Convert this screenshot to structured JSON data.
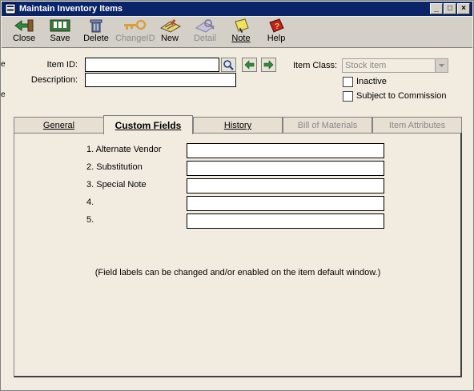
{
  "window": {
    "title": "Maintain Inventory Items"
  },
  "toolbar": {
    "buttons": [
      {
        "label": "Close",
        "icon": "close-icon",
        "enabled": true
      },
      {
        "label": "Save",
        "icon": "save-icon",
        "enabled": true
      },
      {
        "label": "Delete",
        "icon": "delete-icon",
        "enabled": true
      },
      {
        "label": "ChangeID",
        "icon": "change-id-icon",
        "enabled": false
      },
      {
        "label": "New",
        "icon": "new-icon",
        "enabled": true
      },
      {
        "label": "Detail",
        "icon": "detail-icon",
        "enabled": false
      },
      {
        "label": "Note",
        "icon": "note-icon",
        "enabled": true
      },
      {
        "label": "Help",
        "icon": "help-icon",
        "enabled": true
      }
    ]
  },
  "header": {
    "item_id_label": "Item ID:",
    "item_id_value": "",
    "description_label": "Description:",
    "description_value": "",
    "item_class_label": "Item Class:",
    "item_class_value": "Stock item",
    "inactive_label": "Inactive",
    "inactive_checked": false,
    "commission_label": "Subject to Commission",
    "commission_checked": false
  },
  "tabs": [
    {
      "label": "General",
      "active": false,
      "enabled": true
    },
    {
      "label": "Custom Fields",
      "active": true,
      "enabled": true
    },
    {
      "label": "History",
      "active": false,
      "enabled": true
    },
    {
      "label": "Bill of Materials",
      "active": false,
      "enabled": false
    },
    {
      "label": "Item Attributes",
      "active": false,
      "enabled": false
    }
  ],
  "custom_fields": [
    {
      "label": "1. Alternate Vendor",
      "value": ""
    },
    {
      "label": "2. Substitution",
      "value": ""
    },
    {
      "label": "3. Special Note",
      "value": ""
    },
    {
      "label": "4.",
      "value": ""
    },
    {
      "label": "5.",
      "value": ""
    }
  ],
  "note": "(Field labels can be changed and/or enabled on the item default window.)",
  "colors": {
    "titlebar": "#0a246a",
    "window_bg": "#f2ece0",
    "toolbar_bg": "#d4d0c8"
  }
}
